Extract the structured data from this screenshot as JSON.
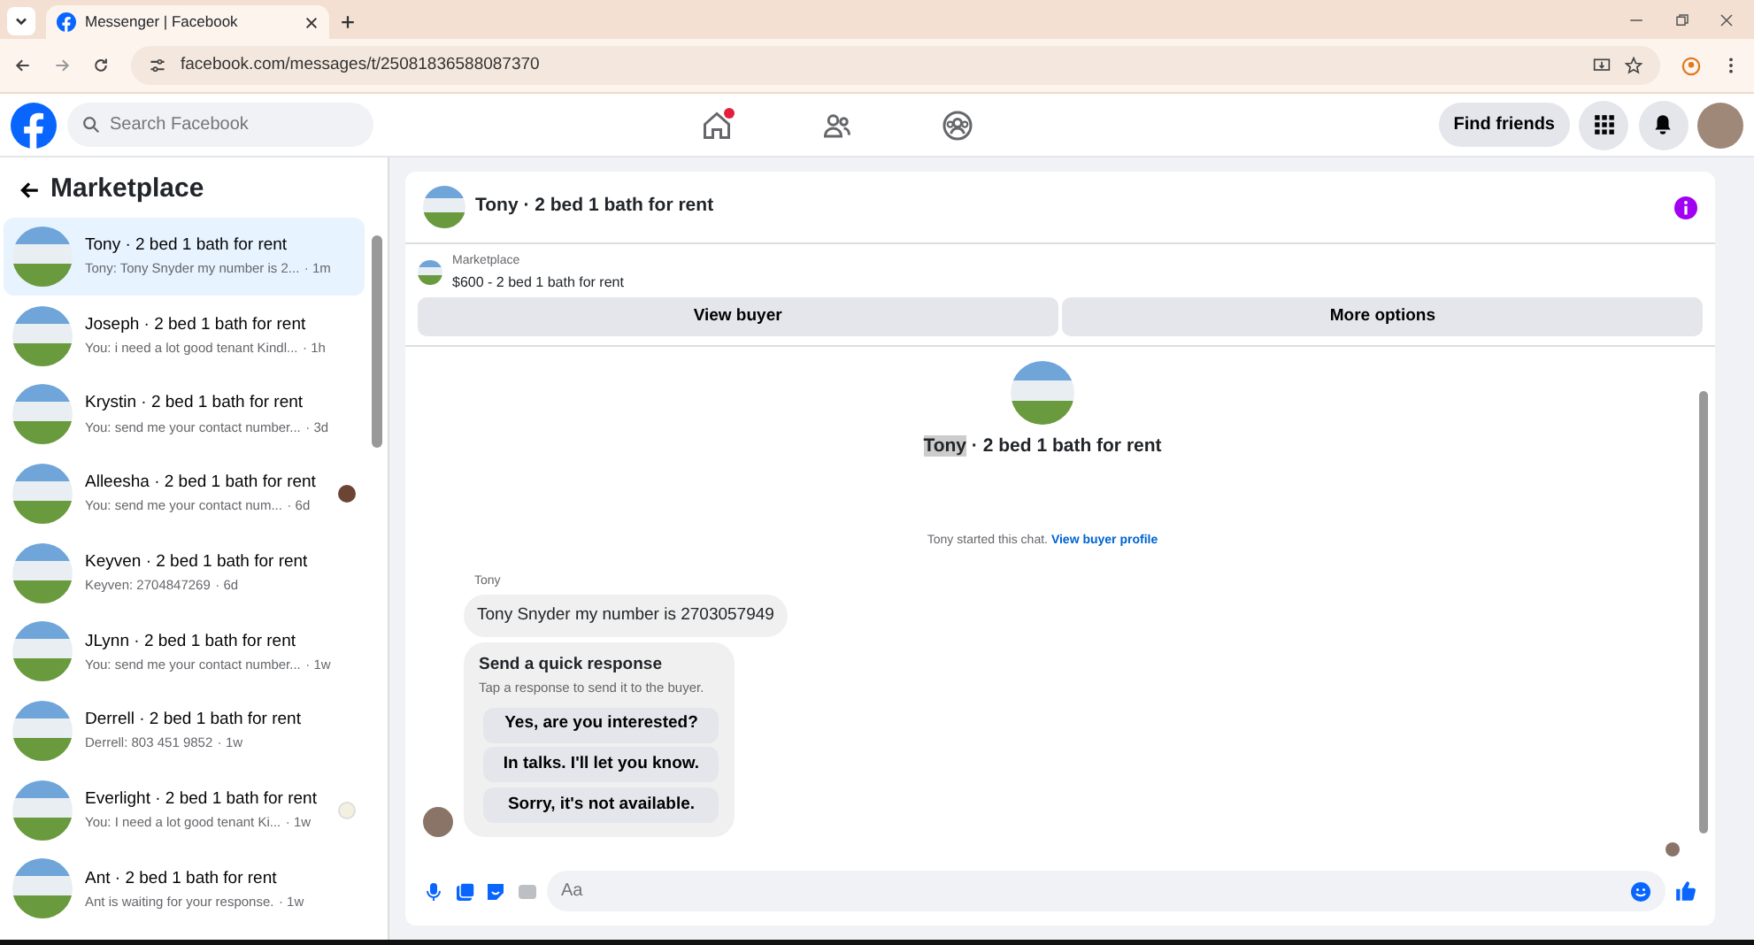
{
  "browser": {
    "tab_title": "Messenger | Facebook",
    "url": "facebook.com/messages/t/25081836588087370"
  },
  "header": {
    "search": {
      "placeholder": "Search Facebook"
    },
    "nav": [
      {
        "kind": "home",
        "notification": true
      },
      {
        "kind": "friends",
        "notification": false
      },
      {
        "kind": "groups",
        "notification": false
      }
    ],
    "find_friends": "Find friends"
  },
  "sidebar": {
    "title": "Marketplace",
    "conversations": [
      {
        "title": "Tony · 2 bed 1 bath for rent",
        "preview": "Tony: Tony Snyder my number is 2...",
        "time": "· 1m",
        "selected": true,
        "kind": "plain"
      },
      {
        "title": "Joseph · 2 bed 1 bath for rent",
        "preview": "You: i need a lot good tenant Kindl...",
        "time": "· 1h",
        "selected": false,
        "kind": "plain"
      },
      {
        "title": "Krystin · 2 bed 1 bath for rent",
        "preview": "You: send me your contact number...",
        "time": "· 3d",
        "selected": false,
        "kind": "plain"
      },
      {
        "title": "Alleesha · 2 bed 1 bath for rent",
        "preview": "You: send me your contact num...",
        "time": "· 6d",
        "selected": false,
        "kind": "seen_avatar"
      },
      {
        "title": "Keyven · 2 bed 1 bath for rent",
        "preview": "Keyven: 2704847269",
        "time": "· 6d",
        "selected": false,
        "kind": "plain"
      },
      {
        "title": "JLynn · 2 bed 1 bath for rent",
        "preview": "You: send me your contact number...",
        "time": "· 1w",
        "selected": false,
        "kind": "plain"
      },
      {
        "title": "Derrell · 2 bed 1 bath for rent",
        "preview": "Derrell: 803 451 9852",
        "time": "· 1w",
        "selected": false,
        "kind": "plain"
      },
      {
        "title": "Everlight · 2 bed 1 bath for rent",
        "preview": "You: I need a lot good tenant Ki...",
        "time": "· 1w",
        "selected": false,
        "kind": "seen_sticker"
      },
      {
        "title": "Ant · 2 bed 1 bath for rent",
        "preview": "Ant is waiting for your response.",
        "time": "· 1w",
        "selected": false,
        "kind": "plain"
      }
    ]
  },
  "chat": {
    "title": "Tony · 2 bed 1 bath for rent",
    "listing": {
      "label": "Marketplace",
      "price_title": "$600 - 2 bed 1 bath for rent"
    },
    "buttons": [
      "View buyer",
      "More options"
    ],
    "intro": {
      "name": "Tony",
      "rest": " · 2 bed 1 bath for rent"
    },
    "started": {
      "text": "Tony started this chat.",
      "link": "View buyer profile"
    },
    "sender": "Tony",
    "message": "Tony Snyder my number is 2703057949",
    "quick": {
      "title": "Send a quick response",
      "subtitle": "Tap a response to send it to the buyer.",
      "options": [
        "Yes, are you interested?",
        "In talks. I'll let you know.",
        "Sorry, it's not available."
      ]
    },
    "composer": {
      "placeholder": "Aa"
    }
  }
}
